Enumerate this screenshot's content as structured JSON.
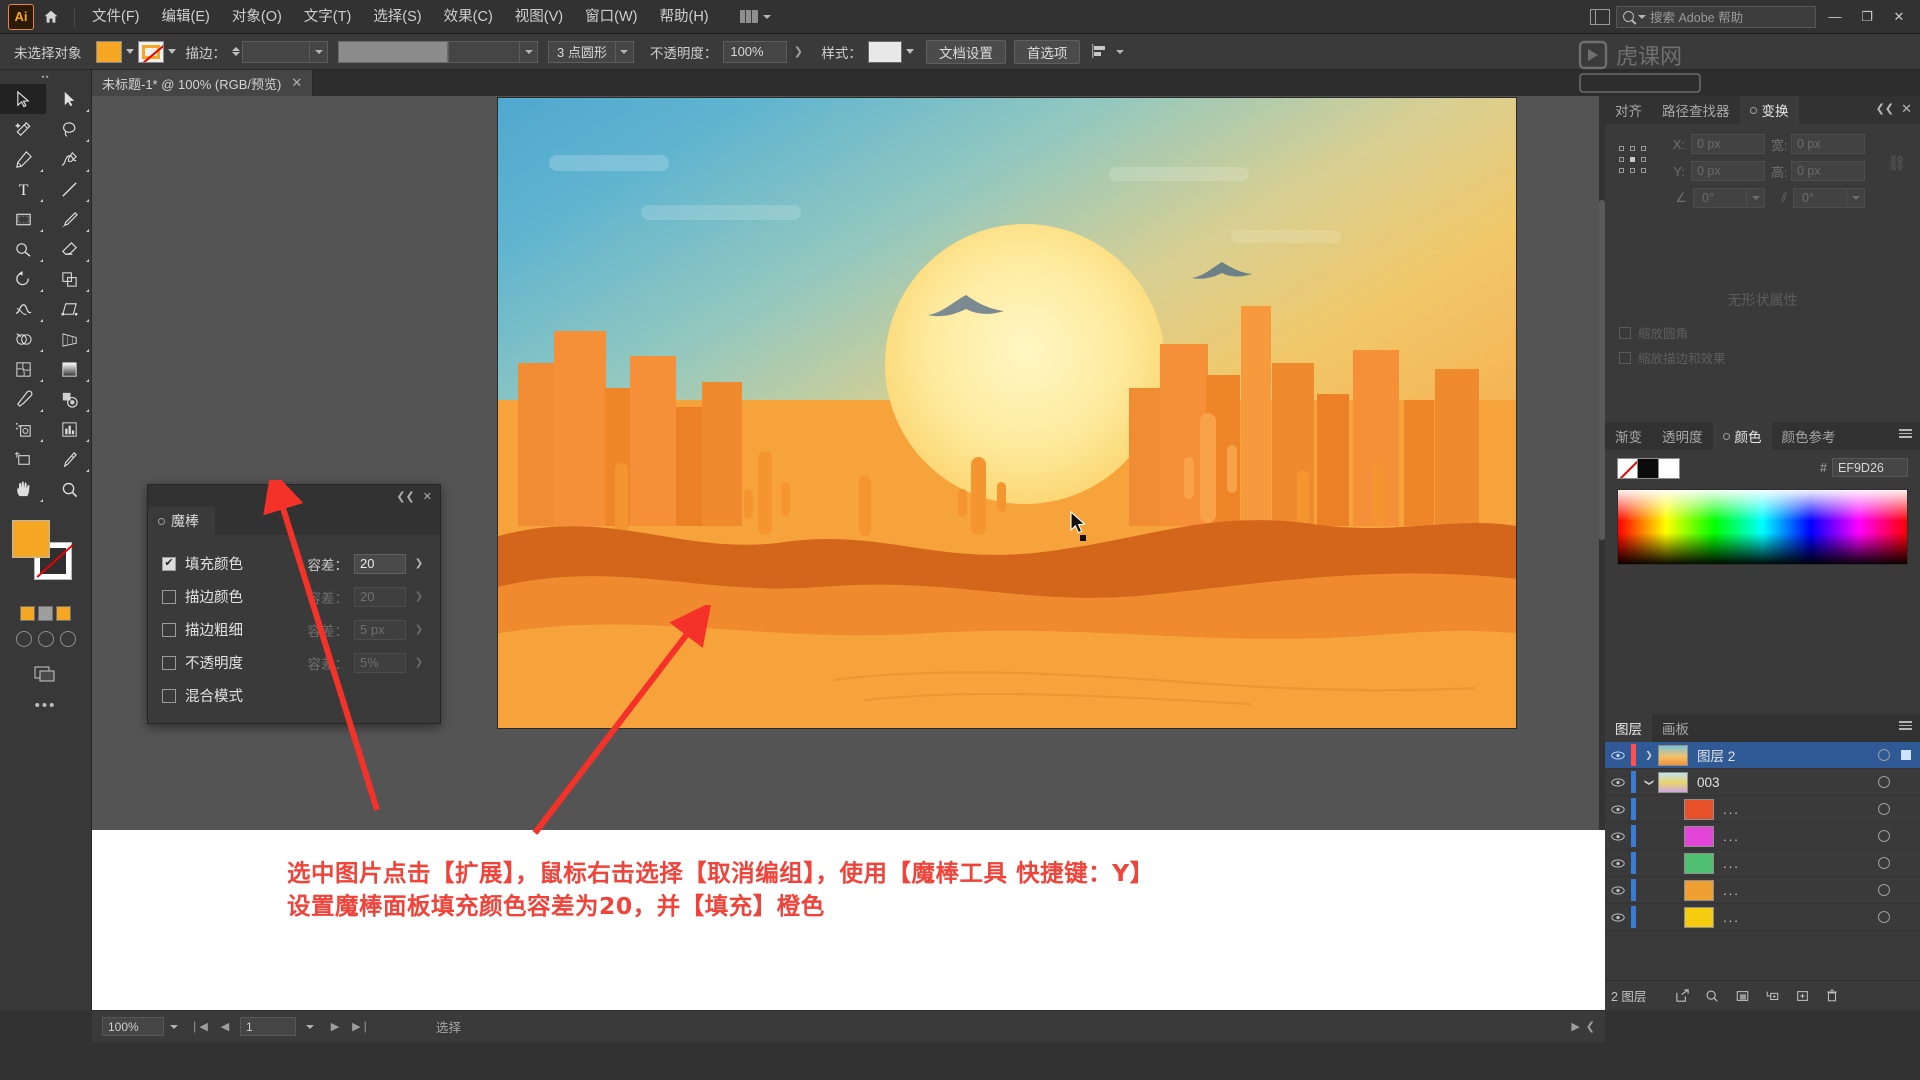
{
  "app": {
    "logo": "Ai",
    "title": "Adobe Illustrator"
  },
  "menubar": {
    "home_icon": "home-icon",
    "items": [
      {
        "label": "文件(F)"
      },
      {
        "label": "编辑(E)"
      },
      {
        "label": "对象(O)"
      },
      {
        "label": "文字(T)"
      },
      {
        "label": "选择(S)"
      },
      {
        "label": "效果(C)"
      },
      {
        "label": "视图(V)"
      },
      {
        "label": "窗口(W)"
      },
      {
        "label": "帮助(H)"
      }
    ],
    "workspace_switcher": "workspace-switcher",
    "search_placeholder": "搜索 Adobe 帮助",
    "window_buttons": {
      "minimize": "—",
      "restore": "❐",
      "close": "✕"
    }
  },
  "controlbar": {
    "selection_label": "未选择对象",
    "fill_color": "#F5A623",
    "stroke_label": "描边：",
    "stroke_weight": "",
    "brush_definition": "",
    "shape_style": "3 点圆形",
    "opacity_label": "不透明度：",
    "opacity_value": "100%",
    "style_label": "样式：",
    "doc_setup_button": "文档设置",
    "preferences_button": "首选项",
    "align_icon": "align-icon"
  },
  "document": {
    "tab_title": "未标题-1* @ 100% (RGB/预览)",
    "close_icon": "✕"
  },
  "toolbar": {
    "tools": [
      {
        "name": "selection-tool",
        "selected": true
      },
      {
        "name": "direct-selection-tool",
        "selected": false
      },
      {
        "name": "magic-wand-tool",
        "selected": false
      },
      {
        "name": "lasso-tool",
        "selected": false
      },
      {
        "name": "pen-tool",
        "selected": false
      },
      {
        "name": "curvature-tool",
        "selected": false
      },
      {
        "name": "type-tool",
        "selected": false
      },
      {
        "name": "line-segment-tool",
        "selected": false
      },
      {
        "name": "rectangle-tool",
        "selected": false
      },
      {
        "name": "paintbrush-tool",
        "selected": false
      },
      {
        "name": "shaper-tool",
        "selected": false
      },
      {
        "name": "eraser-tool",
        "selected": false
      },
      {
        "name": "rotate-tool",
        "selected": false
      },
      {
        "name": "scale-tool",
        "selected": false
      },
      {
        "name": "width-tool",
        "selected": false
      },
      {
        "name": "free-transform-tool",
        "selected": false
      },
      {
        "name": "shape-builder-tool",
        "selected": false
      },
      {
        "name": "perspective-grid-tool",
        "selected": false
      },
      {
        "name": "mesh-tool",
        "selected": false
      },
      {
        "name": "gradient-tool",
        "selected": false
      },
      {
        "name": "eyedropper-tool",
        "selected": false
      },
      {
        "name": "blend-tool",
        "selected": false
      },
      {
        "name": "symbol-sprayer-tool",
        "selected": false
      },
      {
        "name": "column-graph-tool",
        "selected": false
      },
      {
        "name": "artboard-tool",
        "selected": false
      },
      {
        "name": "slice-tool",
        "selected": false
      },
      {
        "name": "hand-tool",
        "selected": false
      },
      {
        "name": "zoom-tool",
        "selected": false
      }
    ],
    "fill_swatch": "#F5A623",
    "stroke_swatch": "#FFFFFF",
    "more_tools": "…"
  },
  "magic_wand_panel": {
    "tab_label": "魔棒",
    "close_icon": "✕",
    "collapse_icon": "❮❮",
    "rows": [
      {
        "label": "填充颜色",
        "checked": true,
        "tolerance_label": "容差：",
        "tolerance_value": "20",
        "enabled": true
      },
      {
        "label": "描边颜色",
        "checked": false,
        "tolerance_label": "容差：",
        "tolerance_value": "20",
        "enabled": false
      },
      {
        "label": "描边粗细",
        "checked": false,
        "tolerance_label": "容差：",
        "tolerance_value": "5 px",
        "enabled": false
      },
      {
        "label": "不透明度",
        "checked": false,
        "tolerance_label": "容差：",
        "tolerance_value": "5%",
        "enabled": false
      },
      {
        "label": "混合模式",
        "checked": false,
        "tolerance_label": "",
        "tolerance_value": "",
        "enabled": false
      }
    ]
  },
  "right_dock": {
    "transform_group": {
      "tabs": [
        {
          "label": "对齐",
          "active": false
        },
        {
          "label": "路径查找器",
          "active": false
        },
        {
          "label": "变换",
          "active": true
        }
      ],
      "fields": [
        {
          "label": "X:",
          "value": "0 px"
        },
        {
          "label": "宽:",
          "value": "0 px"
        },
        {
          "label": "Y:",
          "value": "0 px"
        },
        {
          "label": "高:",
          "value": "0 px"
        },
        {
          "label": "角度:",
          "value": "0°"
        },
        {
          "label": "倾斜:",
          "value": "0°"
        }
      ],
      "empty_text": "无形状属性",
      "checkbox_1": "缩放圆角",
      "checkbox_2": "缩放描边和效果"
    },
    "color_group": {
      "tabs": [
        {
          "label": "渐变",
          "active": false
        },
        {
          "label": "透明度",
          "active": false
        },
        {
          "label": "颜色",
          "active": true
        },
        {
          "label": "颜色参考",
          "active": false
        }
      ],
      "hex_prefix": "#",
      "hex_value": "EF9D26",
      "none_swatch": "none-swatch",
      "black_swatch": "#000000",
      "white_swatch": "#FFFFFF"
    },
    "layers_group": {
      "tabs": [
        {
          "label": "图层",
          "active": true
        },
        {
          "label": "画板",
          "active": false
        }
      ],
      "rows": [
        {
          "name": "图层 2",
          "selected": true,
          "indent": 0,
          "twisty": "▶",
          "color": "#ff4f4f",
          "thumb": "artwork",
          "eye": true
        },
        {
          "name": "003",
          "selected": false,
          "indent": 1,
          "twisty": "▼",
          "color": "#3a7bd5",
          "thumb": "group",
          "eye": true
        },
        {
          "name": "...",
          "selected": false,
          "indent": 2,
          "twisty": "",
          "color": "#3a7bd5",
          "thumb": "#e8502a",
          "eye": true
        },
        {
          "name": "...",
          "selected": false,
          "indent": 2,
          "twisty": "",
          "color": "#3a7bd5",
          "thumb": "#e245d8",
          "eye": true
        },
        {
          "name": "...",
          "selected": false,
          "indent": 2,
          "twisty": "",
          "color": "#3a7bd5",
          "thumb": "#4fbf72",
          "eye": true
        },
        {
          "name": "...",
          "selected": false,
          "indent": 2,
          "twisty": "",
          "color": "#3a7bd5",
          "thumb": "#f0a030",
          "eye": true
        },
        {
          "name": "...",
          "selected": false,
          "indent": 2,
          "twisty": "",
          "color": "#3a7bd5",
          "thumb": "#f5cc10",
          "eye": true
        }
      ],
      "footer_count": "2 图层",
      "footer_icons": [
        "locate-object-icon",
        "search-icon",
        "make-clipping-mask-icon",
        "create-sublayer-icon",
        "create-new-layer-icon",
        "delete-selection-icon"
      ]
    }
  },
  "annotation": {
    "line1": "选中图片点击【扩展】，鼠标右击选择【取消编组】，使用【魔棒工具 快捷键：Y】",
    "line2": "设置魔棒面板填充颜色容差为20，并【填充】橙色",
    "color": "#F0433A",
    "arrow_1": "red-arrow-to-wand-panel",
    "arrow_2": "red-arrow-to-canvas"
  },
  "statusbar": {
    "zoom": "100%",
    "page": "1",
    "status_text": "选择",
    "first_icon": "first-page-icon",
    "prev_icon": "prev-page-icon",
    "next_icon": "next-page-icon",
    "last_icon": "last-page-icon"
  },
  "artwork": {
    "description": "沙漠日落插画",
    "sky_top": "#4FA8CF",
    "sun": "#FDEB9E",
    "sand": "#F6A33C",
    "mesa": "#F08A2E",
    "dune_dark": "#D4641B"
  }
}
